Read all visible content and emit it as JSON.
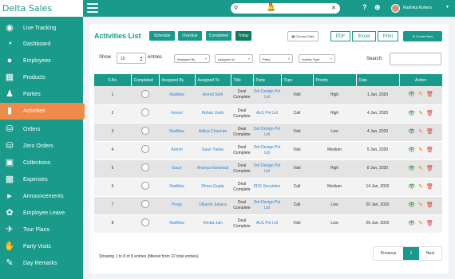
{
  "app": {
    "brand": "Delta Sales"
  },
  "topbar": {
    "search": {
      "placeholder": ""
    },
    "notification_count": "6",
    "user_name": "Radhika Kohera",
    "icons": [
      "menu-icon",
      "search-icon",
      "clear-icon",
      "bell-icon",
      "help-icon",
      "add-circle-icon",
      "avatar",
      "chevron-down-icon"
    ]
  },
  "sidebar": {
    "items": [
      {
        "label": "Live Tracking",
        "icon": "location-pin-icon"
      },
      {
        "label": "Dashboard",
        "icon": "dashboard-icon"
      },
      {
        "label": "Employees",
        "icon": "user-icon"
      },
      {
        "label": "Products",
        "icon": "grid-icon"
      },
      {
        "label": "Parties",
        "icon": "users-icon"
      },
      {
        "label": "Activities",
        "icon": "file-icon",
        "active": true
      },
      {
        "label": "Orders",
        "icon": "cart-icon"
      },
      {
        "label": "Zero Orders",
        "icon": "cart-icon"
      },
      {
        "label": "Collections",
        "icon": "money-icon"
      },
      {
        "label": "Expenses",
        "icon": "wallet-icon"
      },
      {
        "label": "Announcements",
        "icon": "megaphone-icon"
      },
      {
        "label": "Employee Leave",
        "icon": "leaf-icon"
      },
      {
        "label": "Tour Plans",
        "icon": "plane-icon"
      },
      {
        "label": "Party Visits",
        "icon": "handshake-icon"
      },
      {
        "label": "Day Remarks",
        "icon": "note-icon"
      }
    ]
  },
  "main": {
    "title": "Activities List",
    "filters": [
      "Schedule",
      "Overdue",
      "Completed",
      "Today"
    ],
    "choose_date": "Choose Date",
    "export": [
      "PDF",
      "Excel",
      "Print"
    ],
    "create_label": "Create New",
    "show_label": "Show",
    "show_value": "10",
    "entries_label": "entries",
    "selects": [
      "Assigned By",
      "Assigned to",
      "Party",
      "Activity Type"
    ],
    "search_label": "Search:",
    "columns": [
      "S.No",
      "Completed",
      "Assigned By",
      "Assigned To",
      "Title",
      "Party",
      "Type",
      "Priority",
      "Date",
      "Action"
    ],
    "rows": [
      {
        "sno": "1",
        "by": "Radhika",
        "to": "Anmol Seth",
        "title": "Deal Complete",
        "party": "Dot Design Pvt Ltd",
        "type": "Visit",
        "priority": "High",
        "date": "1 Jan, 2020"
      },
      {
        "sno": "2",
        "by": "Anmol",
        "to": "Rohan Joshi",
        "title": "Deal Complete",
        "party": "ALG Pvt Ltd",
        "type": "Call",
        "priority": "High",
        "date": "4 Jan, 2020"
      },
      {
        "sno": "3",
        "by": "Radhika",
        "to": "Aditya Chauhan",
        "title": "Deal Complete",
        "party": "Dot Design Pvt Ltd",
        "type": "Visit",
        "priority": "Low",
        "date": "4 Jan, 2020"
      },
      {
        "sno": "4",
        "by": "Anmol",
        "to": "Gauri Yadav",
        "title": "Deal Complete",
        "party": "Dot Design Pvt Ltd",
        "type": "Visit",
        "priority": "Medium",
        "date": "5 Jan, 2020"
      },
      {
        "sno": "5",
        "by": "Gauri",
        "to": "Ananya Karanwal",
        "title": "Deal Complete",
        "party": "Dot Design Pvt Ltd",
        "type": "Visit",
        "priority": "High",
        "date": "8 Jan, 2020"
      },
      {
        "sno": "6",
        "by": "Radhika",
        "to": "Dhruv Gupta",
        "title": "Deal Complete",
        "party": "PDS Securities",
        "type": "Call",
        "priority": "Medium",
        "date": "14 Jan, 2020"
      },
      {
        "sno": "7",
        "by": "Pooja",
        "to": "Utkarsh Jukaria",
        "title": "Deal Complete",
        "party": "Dot Design Pvt Ltd",
        "type": "Call",
        "priority": "Low",
        "date": "20 Jan, 2020"
      },
      {
        "sno": "8",
        "by": "Radhika",
        "to": "Vrinda Jain",
        "title": "Deal Complete",
        "party": "ALG Pvt Ltd",
        "type": "Visit",
        "priority": "Low",
        "date": "26 Jan, 2020"
      }
    ],
    "info": "Showing 1 to 8 of 8 entries (filtered from 22 total entries)",
    "pager": {
      "prev": "Previous",
      "current": "1",
      "next": "Next"
    }
  },
  "colors": {
    "primary": "#1a9a8a",
    "active": "#f08a4b",
    "link": "#2b84d6"
  }
}
